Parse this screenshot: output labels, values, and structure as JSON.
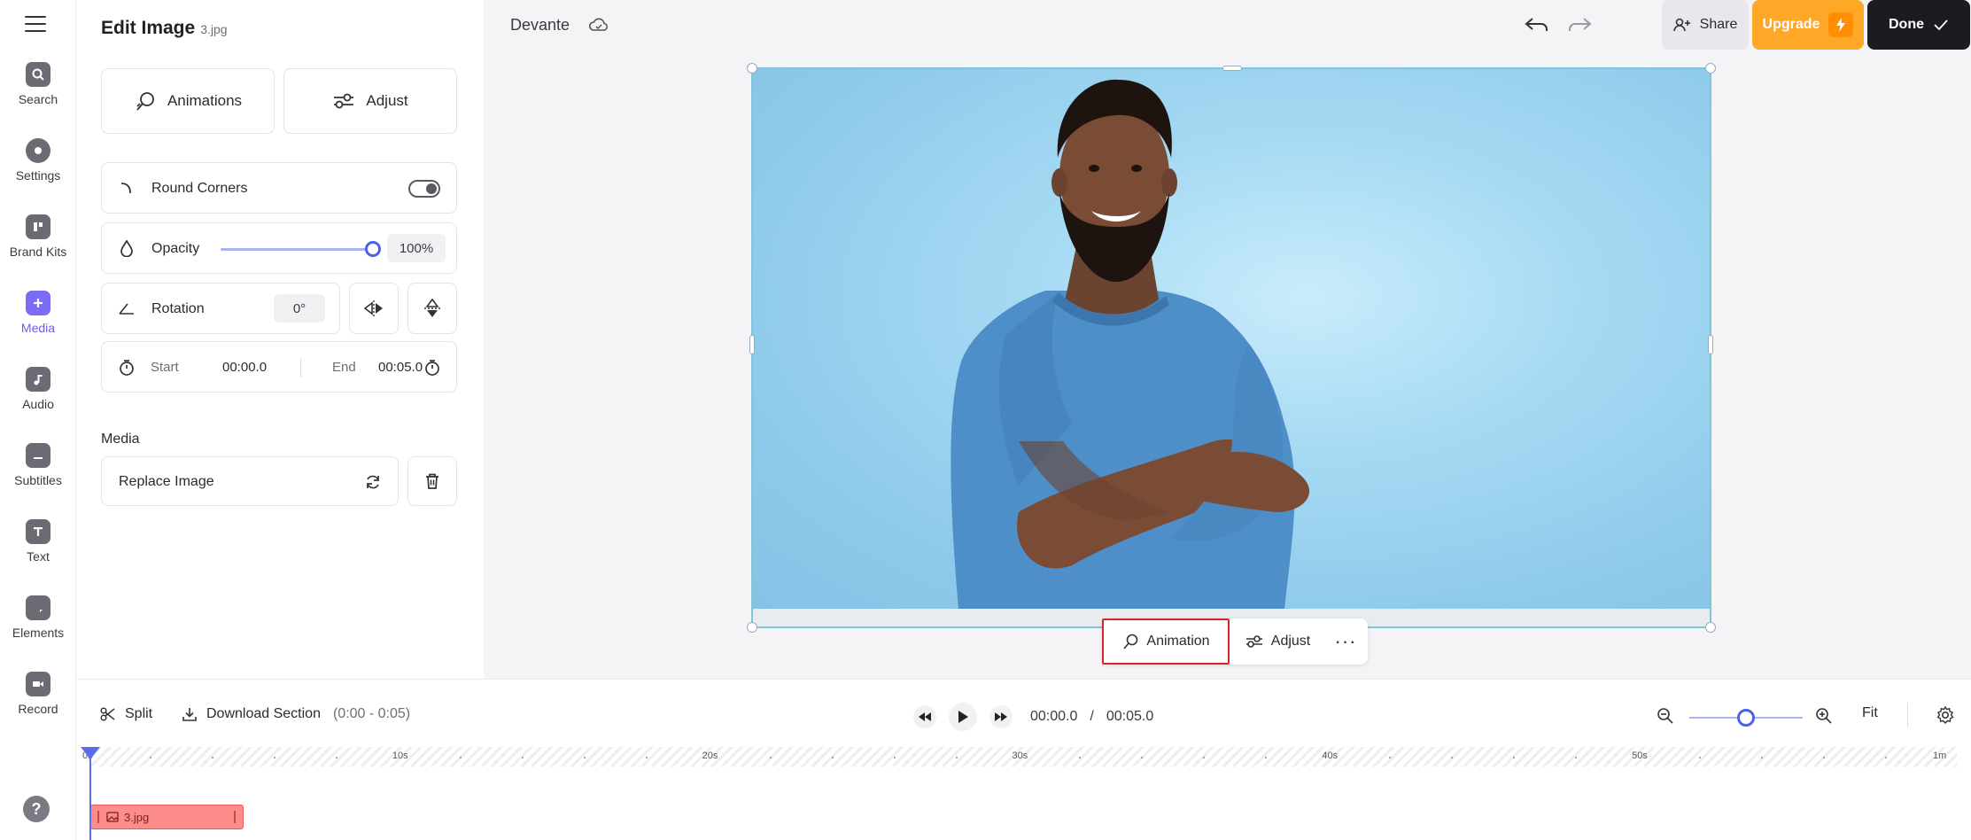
{
  "rail": {
    "items": [
      {
        "label": "Search",
        "icon": "search-icon",
        "active": false
      },
      {
        "label": "Settings",
        "icon": "settings-icon",
        "active": false
      },
      {
        "label": "Brand Kits",
        "icon": "brand-kits-icon",
        "active": false
      },
      {
        "label": "Media",
        "icon": "plus-icon",
        "active": true
      },
      {
        "label": "Audio",
        "icon": "music-note-icon",
        "active": false
      },
      {
        "label": "Subtitles",
        "icon": "subtitles-icon",
        "active": false
      },
      {
        "label": "Text",
        "icon": "text-icon",
        "active": false
      },
      {
        "label": "Elements",
        "icon": "elements-icon",
        "active": false
      },
      {
        "label": "Record",
        "icon": "video-camera-icon",
        "active": false
      }
    ],
    "help_label": "?"
  },
  "panel": {
    "title": "Edit Image",
    "filename": "3.jpg",
    "animations_label": "Animations",
    "adjust_label": "Adjust",
    "round_corners_label": "Round Corners",
    "round_corners_on": false,
    "opacity_label": "Opacity",
    "opacity_value": "100%",
    "opacity_fraction": 1.0,
    "rotation_label": "Rotation",
    "rotation_value": "0°",
    "start_label": "Start",
    "start_value": "00:00.0",
    "end_label": "End",
    "end_value": "00:05.0",
    "media_section": "Media",
    "replace_label": "Replace Image"
  },
  "header": {
    "project_name": "Devante",
    "share_label": "Share",
    "upgrade_label": "Upgrade",
    "done_label": "Done"
  },
  "canvas_toolbar": {
    "animation_label": "Animation",
    "adjust_label": "Adjust",
    "more_label": "···"
  },
  "timeline": {
    "split_label": "Split",
    "download_label": "Download Section",
    "download_range": "(0:00 - 0:05)",
    "current_time": "00:00.0",
    "separator": "/",
    "total_time": "00:05.0",
    "fit_label": "Fit",
    "ruler_labels": [
      "0s",
      "10s",
      "20s",
      "30s",
      "40s",
      "50s",
      "1m"
    ],
    "clip_label": "3.jpg"
  },
  "colors": {
    "accent": "#6b5cf0",
    "upgrade": "#ffa726",
    "done": "#1c1c20",
    "highlight": "#d9242b",
    "clip": "#fc8d8a"
  }
}
